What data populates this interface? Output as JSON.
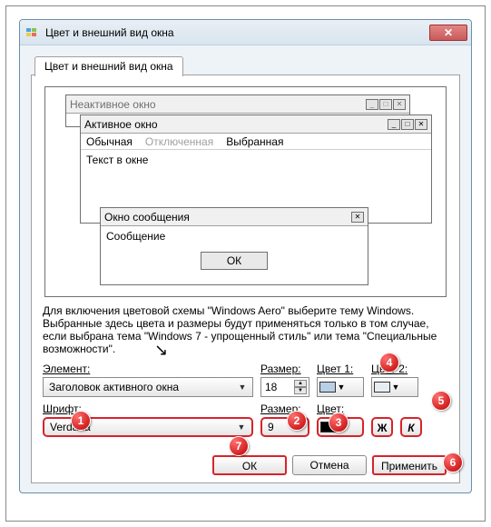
{
  "window_title": "Цвет и внешний вид окна",
  "tab_label": "Цвет и внешний вид окна",
  "preview": {
    "inactive_title": "Неактивное окно",
    "active_title": "Активное окно",
    "menu_normal": "Обычная",
    "menu_disabled": "Отключенная",
    "menu_selected": "Выбранная",
    "body_text": "Текст в окне",
    "msg_title": "Окно сообщения",
    "msg_body": "Сообщение",
    "ok": "ОК"
  },
  "info_text": "Для включения цветовой схемы \"Windows Aero\" выберите тему Windows. Выбранные здесь цвета и размеры будут применяться только в том случае, если выбрана тема \"Windows 7 - упрощенный стиль\" или тема \"Специальные возможности\".",
  "row1": {
    "element_label": "Элемент:",
    "element_value": "Заголовок активного окна",
    "size_label": "Размер:",
    "size_value": "18",
    "color1_label": "Цвет 1:",
    "color2_label": "Цвет 2:"
  },
  "row2": {
    "font_label": "Шрифт:",
    "font_value": "Verdana",
    "size_label": "Размер:",
    "size_value": "9",
    "color_label": "Цвет:",
    "bold": "Ж",
    "italic": "К"
  },
  "buttons": {
    "ok": "ОК",
    "cancel": "Отмена",
    "apply": "Применить"
  },
  "markers": {
    "m1": "1",
    "m2": "2",
    "m3": "3",
    "m4": "4",
    "m5": "5",
    "m6": "6",
    "m7": "7"
  }
}
